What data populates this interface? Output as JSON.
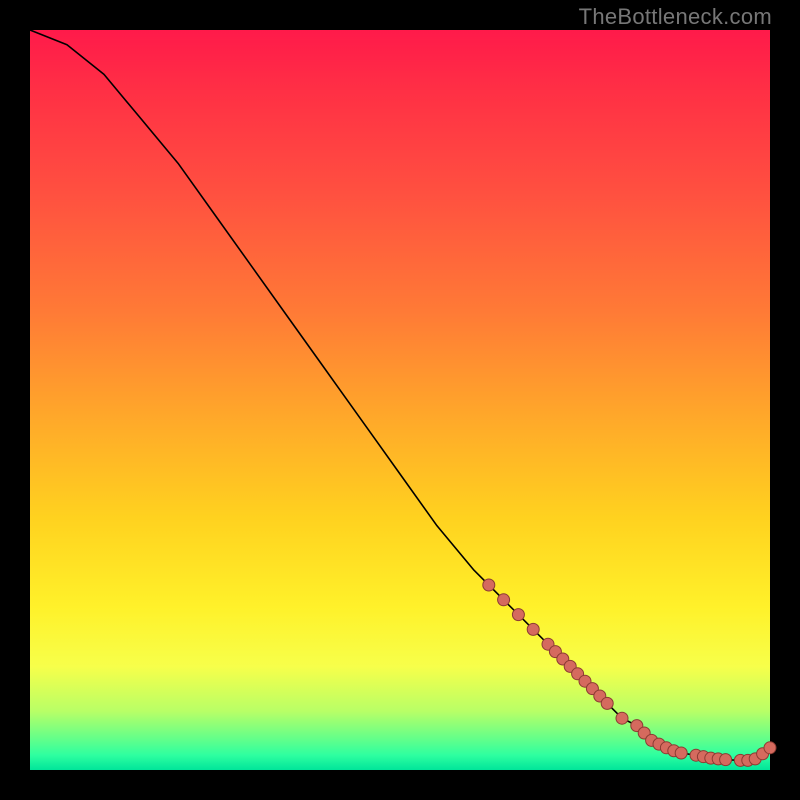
{
  "watermark": "TheBottleneck.com",
  "chart_data": {
    "type": "line",
    "title": "",
    "xlabel": "",
    "ylabel": "",
    "xlim": [
      0,
      100
    ],
    "ylim": [
      0,
      100
    ],
    "grid": false,
    "legend": false,
    "series": [
      {
        "name": "bottleneck-curve",
        "x": [
          0,
          5,
          10,
          15,
          20,
          25,
          30,
          35,
          40,
          45,
          50,
          55,
          60,
          62,
          64,
          66,
          68,
          70,
          71,
          72,
          73,
          74,
          75,
          76,
          77,
          78,
          80,
          82,
          83,
          84,
          85,
          86,
          87,
          88,
          90,
          91,
          92,
          93,
          94,
          96,
          97,
          98,
          99,
          100
        ],
        "y": [
          100,
          98,
          94,
          88,
          82,
          75,
          68,
          61,
          54,
          47,
          40,
          33,
          27,
          25,
          23,
          21,
          19,
          17,
          16,
          15,
          14,
          13,
          12,
          11,
          10,
          9,
          7,
          6,
          5,
          4,
          3.5,
          3,
          2.6,
          2.3,
          2,
          1.8,
          1.6,
          1.5,
          1.4,
          1.3,
          1.3,
          1.5,
          2.2,
          3
        ]
      }
    ],
    "markers": {
      "name": "highlight-points",
      "x": [
        62,
        64,
        66,
        68,
        70,
        71,
        72,
        73,
        74,
        75,
        76,
        77,
        78,
        80,
        82,
        83,
        84,
        85,
        86,
        87,
        88,
        90,
        91,
        92,
        93,
        94,
        96,
        97,
        98,
        99,
        100
      ],
      "y": [
        25,
        23,
        21,
        19,
        17,
        16,
        15,
        14,
        13,
        12,
        11,
        10,
        9,
        7,
        6,
        5,
        4,
        3.5,
        3,
        2.6,
        2.3,
        2,
        1.8,
        1.6,
        1.5,
        1.4,
        1.3,
        1.3,
        1.5,
        2.2,
        3
      ]
    }
  }
}
